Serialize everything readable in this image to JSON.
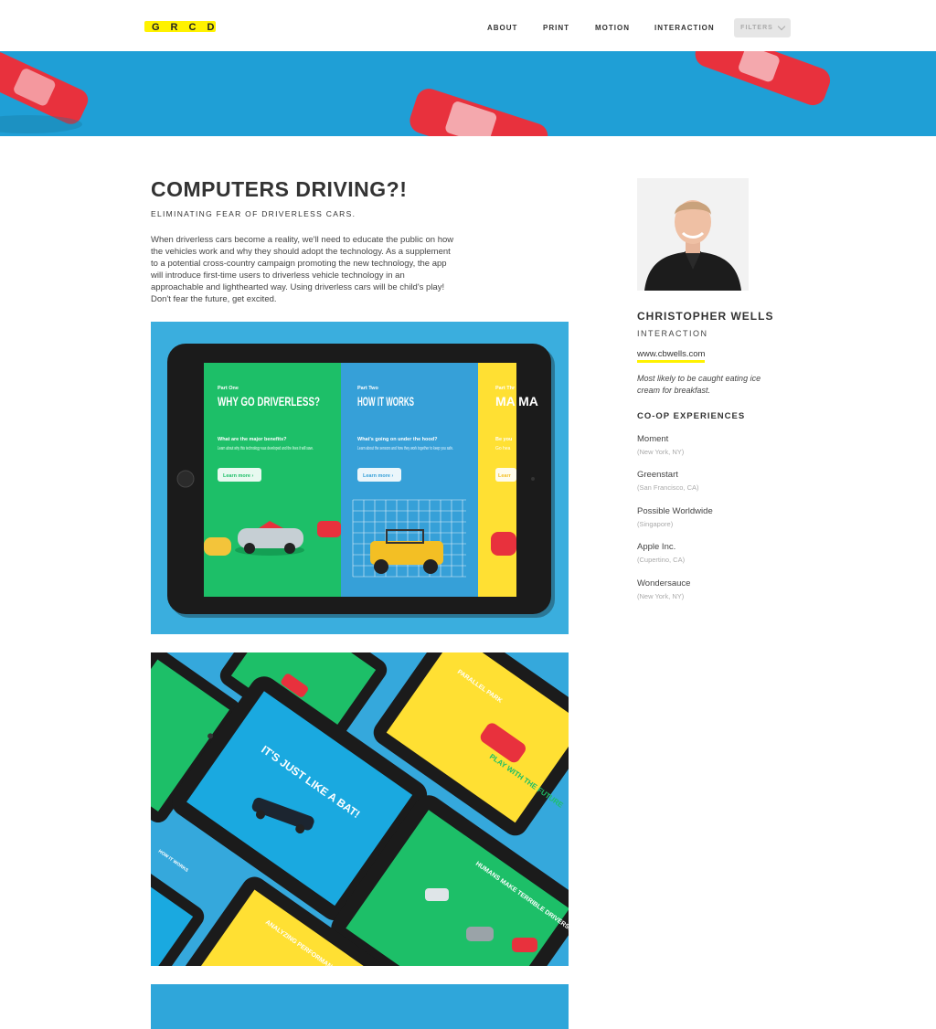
{
  "header": {
    "logo": "GRCD",
    "nav": [
      "ABOUT",
      "PRINT",
      "MOTION",
      "INTERACTION"
    ],
    "filters_label": "FILTERS"
  },
  "project": {
    "title": "COMPUTERS DRIVING?!",
    "subtitle": "ELIMINATING FEAR OF DRIVERLESS CARS.",
    "description": "When driverless cars become a reality, we'll need to educate the public on how the vehicles work and why they should adopt the technology. As a supplement to a potential cross-country campaign promoting the new technology, the app will introduce first-time users to driverless vehicle technology in an approachable and lighthearted way. Using driverless cars will be child's play! Don't fear the future, get excited."
  },
  "tablet": {
    "panel1": {
      "part": "Part One",
      "headline": "WHY GO DRIVERLESS?",
      "question": "What are the major benefits?",
      "body": "Learn about why this technology was developed and the lives it will save.",
      "button": "Learn more ›"
    },
    "panel2": {
      "part": "Part Two",
      "headline": "HOW IT WORKS",
      "question": "What's going on under the hood?",
      "body": "Learn about the sensors and how they work together to keep you safe.",
      "button": "Learn more ›"
    },
    "panel3": {
      "part": "Part Thr",
      "headline": "MA MA",
      "question": "Be you",
      "body": "Go hea",
      "button": "Learr"
    }
  },
  "collage": {
    "center": "IT'S JUST LIKE A BAT!",
    "yellow_right": "PLAY WITH THE FUTURE",
    "green_right": "HUMANS MAKE TERRIBLE DRIVERS.",
    "yellow_bottom": "ANALYZING PERFORMANCE",
    "top_right": "PARALLEL PARK",
    "blue_left": "HOW IT WORKS"
  },
  "author": {
    "name": "CHRISTOPHER WELLS",
    "discipline": "INTERACTION",
    "website": "www.cbwells.com",
    "quote": "Most likely to be caught eating ice cream for breakfast.",
    "coop_heading": "CO-OP EXPERIENCES",
    "experiences": [
      {
        "company": "Moment",
        "location": "(New York, NY)"
      },
      {
        "company": "Greenstart",
        "location": "(San Francisco, CA)"
      },
      {
        "company": "Possible Worldwide",
        "location": "(Singapore)"
      },
      {
        "company": "Apple Inc.",
        "location": "(Cupertino, CA)"
      },
      {
        "company": "Wondersauce",
        "location": "(New York, NY)"
      }
    ]
  },
  "colors": {
    "accent_yellow": "#fff200",
    "hero_blue": "#1f9fd6",
    "app_green": "#1dbf68",
    "app_yellow": "#ffe033",
    "car_red": "#e8313d"
  }
}
